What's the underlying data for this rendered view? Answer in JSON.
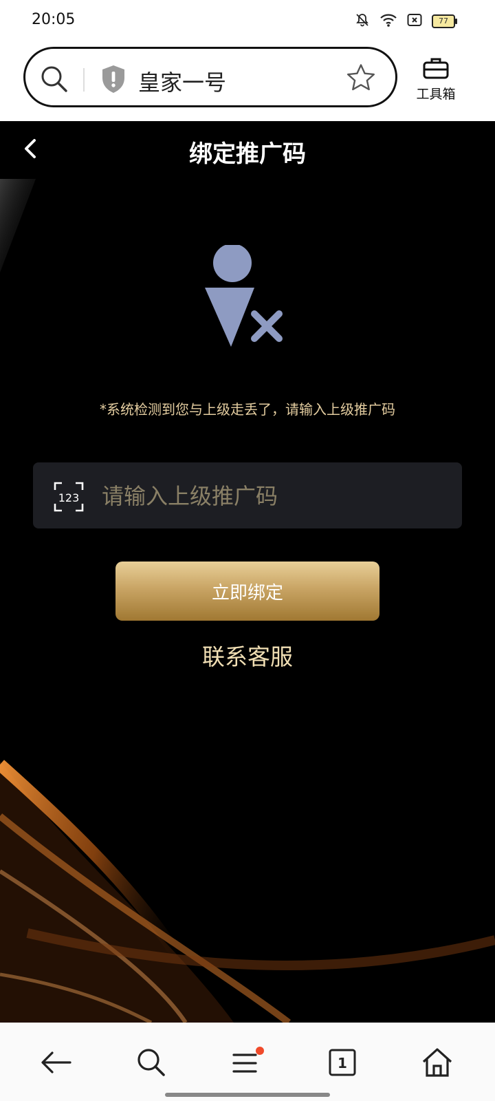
{
  "status_bar": {
    "time": "20:05",
    "battery": "77"
  },
  "browser": {
    "url_title": "皇家一号",
    "toolbox_label": "工具箱",
    "tab_count": "1"
  },
  "page": {
    "title": "绑定推广码",
    "notice": "*系统检测到您与上级走丢了，请输入上级推广码",
    "code_icon_text": "123",
    "code_placeholder": "请输入上级推广码",
    "code_value": "",
    "bind_button": "立即绑定",
    "support_link": "联系客服"
  },
  "colors": {
    "accent_gold": "#c9a565",
    "notice_text": "#e4cda0",
    "icon_blue": "#8e9bc2"
  },
  "icons": [
    "bell-off-icon",
    "wifi-icon",
    "close-box-icon",
    "battery-icon",
    "search-icon",
    "shield-icon",
    "star-icon",
    "toolbox-icon",
    "back-icon",
    "user-missing-icon",
    "scan-123-icon",
    "arrow-left-icon",
    "menu-icon",
    "tabs-icon",
    "home-icon"
  ]
}
